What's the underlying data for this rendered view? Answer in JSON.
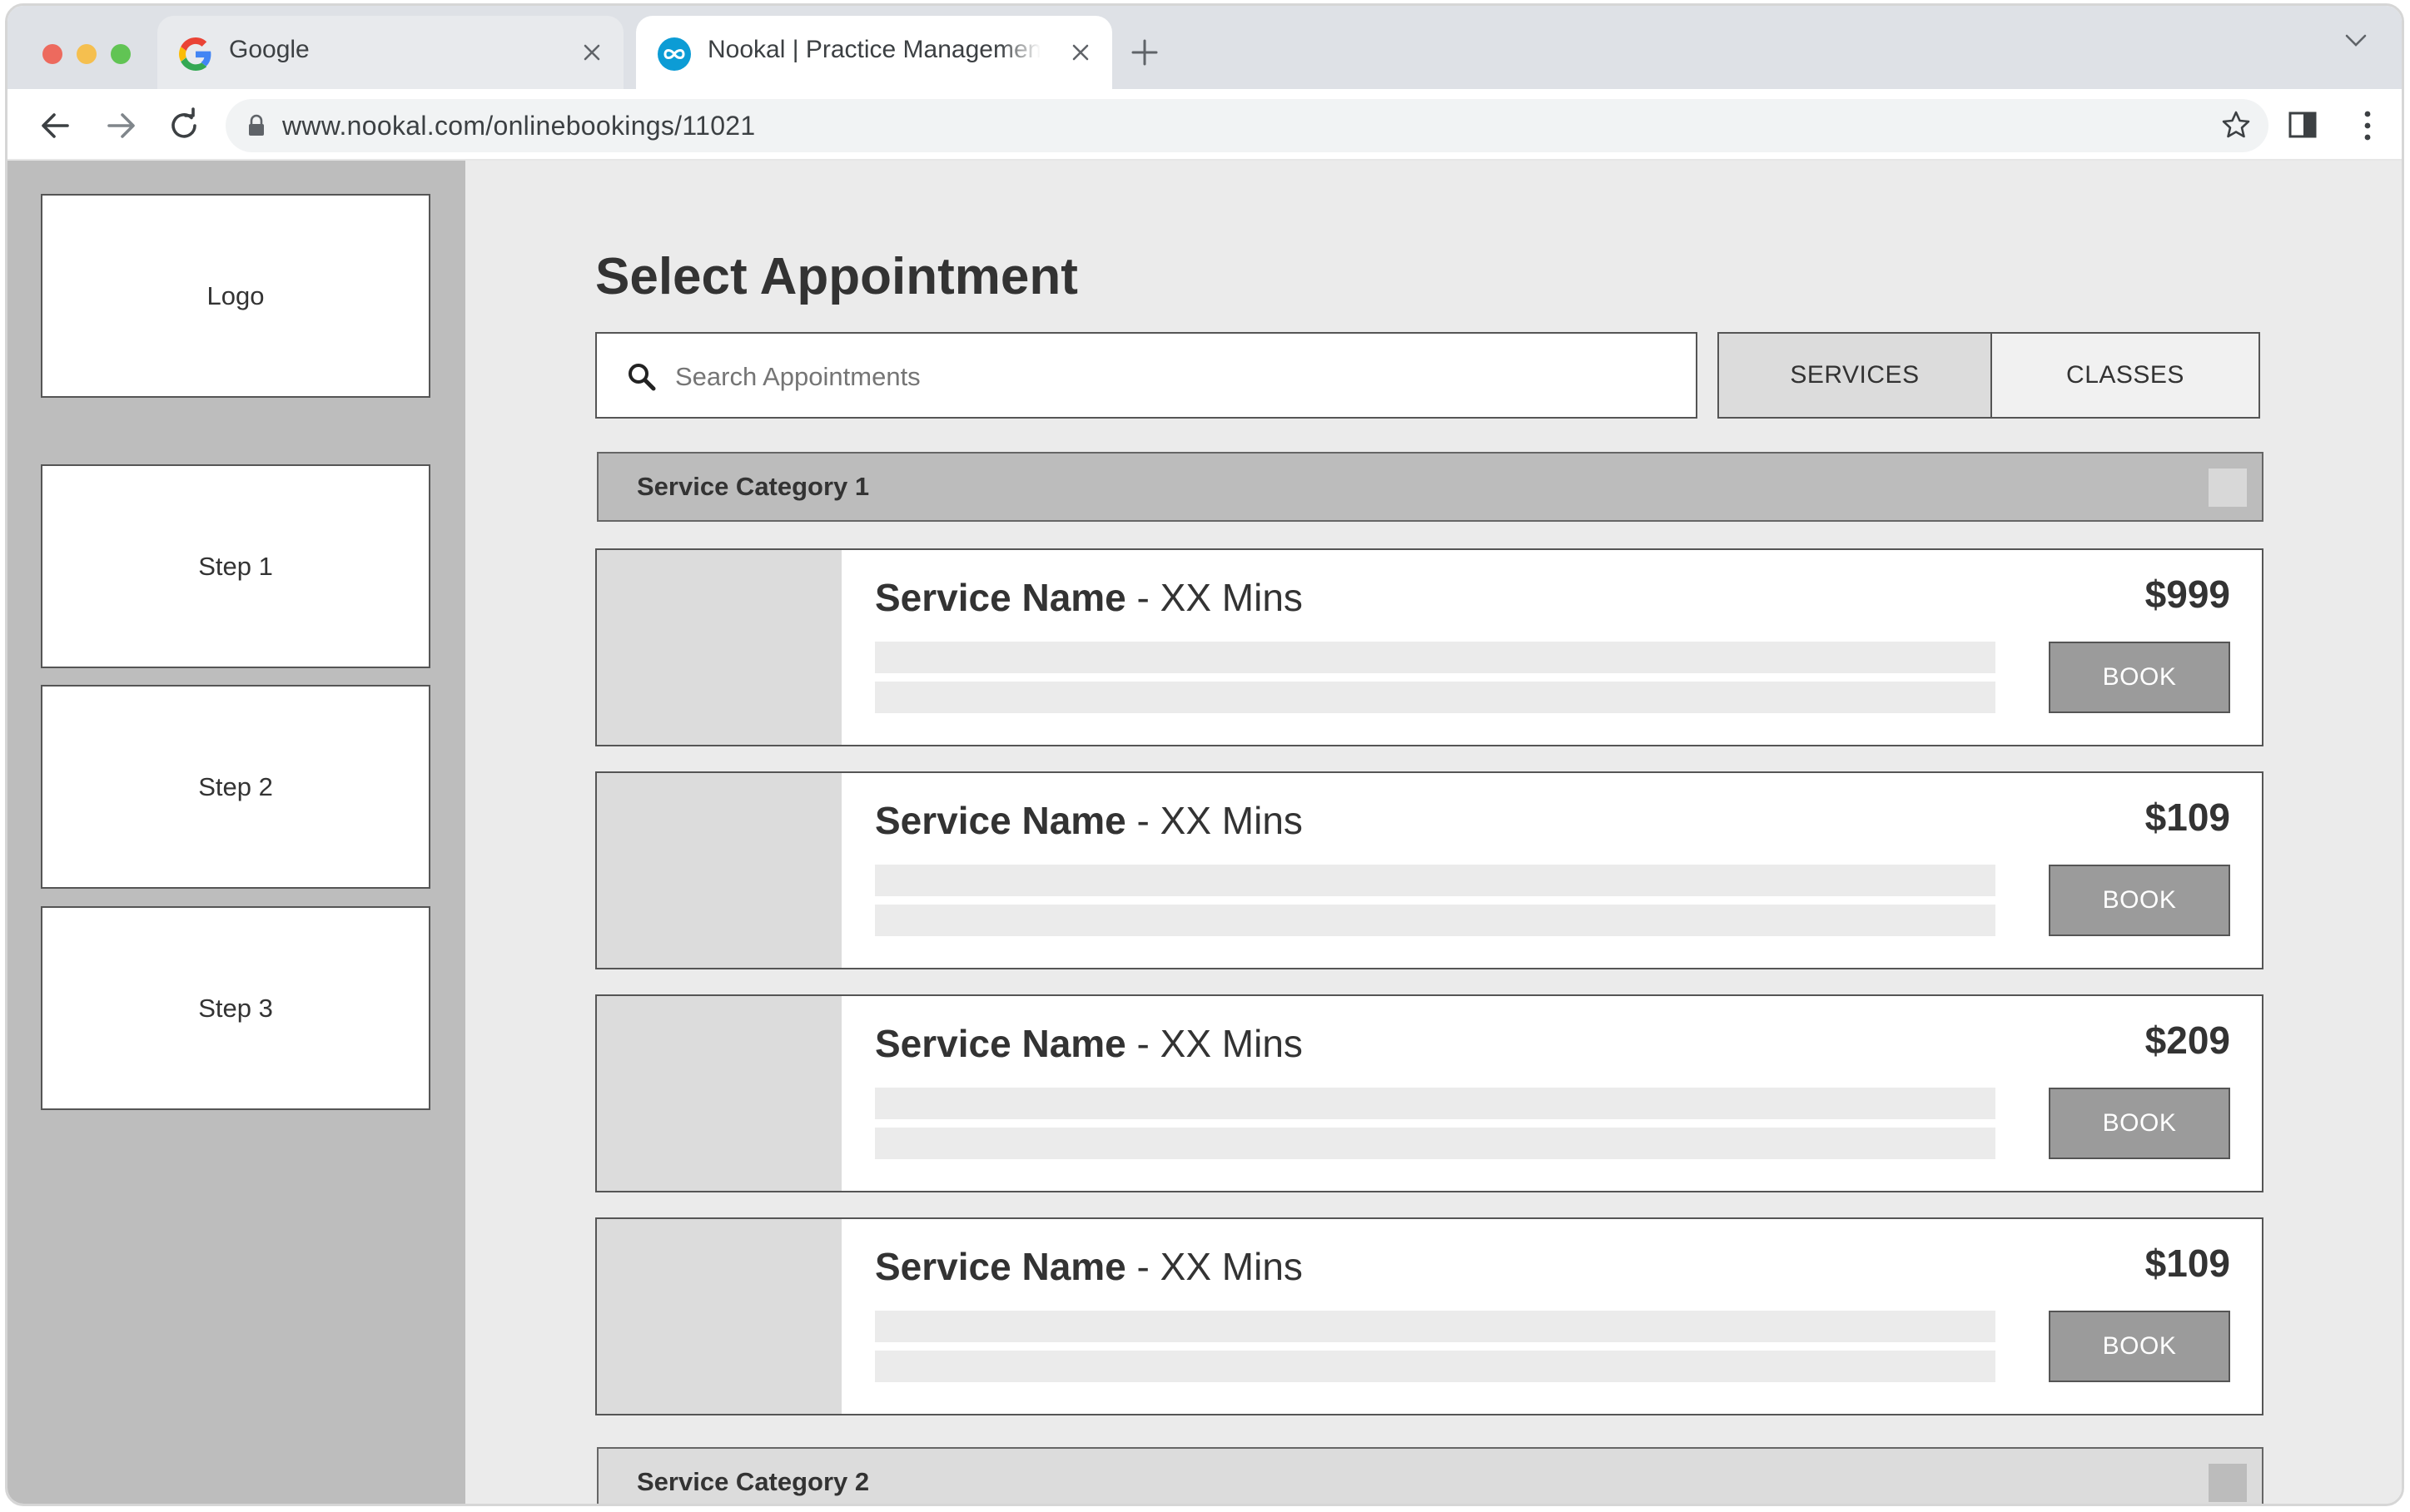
{
  "browser": {
    "tabs": [
      {
        "title": "Google",
        "favicon": "google-icon",
        "active": false
      },
      {
        "title": "Nookal | Practice Management",
        "favicon": "nookal-icon",
        "active": true
      }
    ],
    "url": "www.nookal.com/onlinebookings/11021"
  },
  "sidebar": {
    "logo_label": "Logo",
    "steps": [
      {
        "label": "Step 1"
      },
      {
        "label": "Step 2"
      },
      {
        "label": "Step 3"
      }
    ]
  },
  "main": {
    "title": "Select Appointment",
    "search": {
      "placeholder": "Search Appointments"
    },
    "tabs": [
      {
        "label": "SERVICES",
        "selected": true
      },
      {
        "label": "CLASSES",
        "selected": false
      }
    ],
    "categories": [
      {
        "name": "Service Category 1",
        "services": [
          {
            "name": "Service Name",
            "duration": " - XX Mins",
            "price": "$999",
            "action": "BOOK"
          },
          {
            "name": "Service Name",
            "duration": " - XX Mins",
            "price": "$109",
            "action": "BOOK"
          },
          {
            "name": "Service Name",
            "duration": " - XX Mins",
            "price": "$209",
            "action": "BOOK"
          },
          {
            "name": "Service Name",
            "duration": " - XX Mins",
            "price": "$109",
            "action": "BOOK"
          }
        ]
      },
      {
        "name": "Service Category 2",
        "services": []
      }
    ]
  },
  "colors": {
    "sidebar_bg": "#bdbdbd",
    "page_bg": "#ebebeb",
    "button_bg": "#9b9b9b",
    "category_bg": "#bcbcbc"
  }
}
